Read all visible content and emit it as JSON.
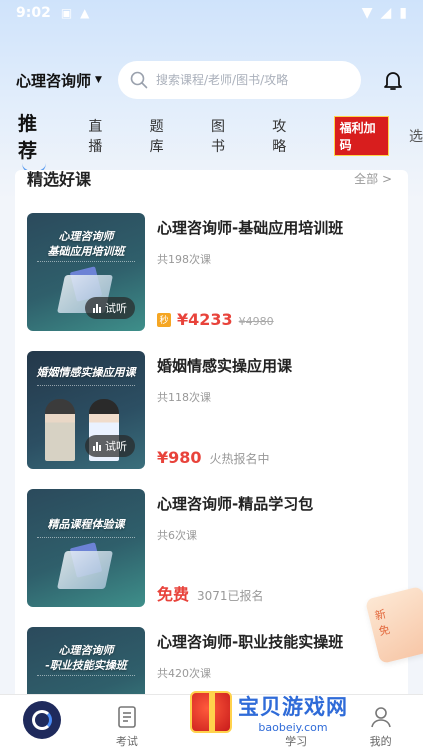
{
  "status_bar": {
    "time": "9:02"
  },
  "header": {
    "category_label": "心理咨询师",
    "search_placeholder": "搜索课程/老师/图书/攻略"
  },
  "tabs": [
    {
      "label": "推荐"
    },
    {
      "label": "直播"
    },
    {
      "label": "题库"
    },
    {
      "label": "图书"
    },
    {
      "label": "攻略"
    }
  ],
  "tab_promo_label": "福利加码",
  "tab_more": "选",
  "section": {
    "title": "精选好课",
    "all_label": "全部 >"
  },
  "courses": [
    {
      "thumb_title_1": "心理咨询师",
      "thumb_title_2": "基础应用培训班",
      "title": "心理咨询师-基础应用培训班",
      "lessons": "共198次课",
      "trial": "试听",
      "badge": "秒",
      "price": "¥4233",
      "original_price": "¥4980"
    },
    {
      "thumb_title_1": "婚姻情感实操应用课",
      "title": "婚姻情感实操应用课",
      "lessons": "共118次课",
      "trial": "试听",
      "price": "¥980",
      "meta": "火热报名中"
    },
    {
      "thumb_title_1": "精品课程体验课",
      "title": "心理咨询师-精品学习包",
      "lessons": "共6次课",
      "price": "免费",
      "meta": "3071已报名"
    },
    {
      "thumb_title_1": "心理咨询师",
      "thumb_title_2": "-职业技能实操班",
      "title": "心理咨询师-职业技能实操班",
      "lessons": "共420次课"
    }
  ],
  "float_banner": {
    "line1": "新",
    "line2": "免"
  },
  "bottom_nav": [
    {
      "label": ""
    },
    {
      "label": "考试"
    },
    {
      "label": ""
    },
    {
      "label": "学习"
    },
    {
      "label": "我的"
    }
  ],
  "watermark": {
    "title": "宝贝游戏网",
    "url": "baobeiy.com"
  },
  "colors": {
    "accent": "#5b9cf0",
    "price": "#e8433b",
    "nav_dark": "#1f2a5c"
  }
}
